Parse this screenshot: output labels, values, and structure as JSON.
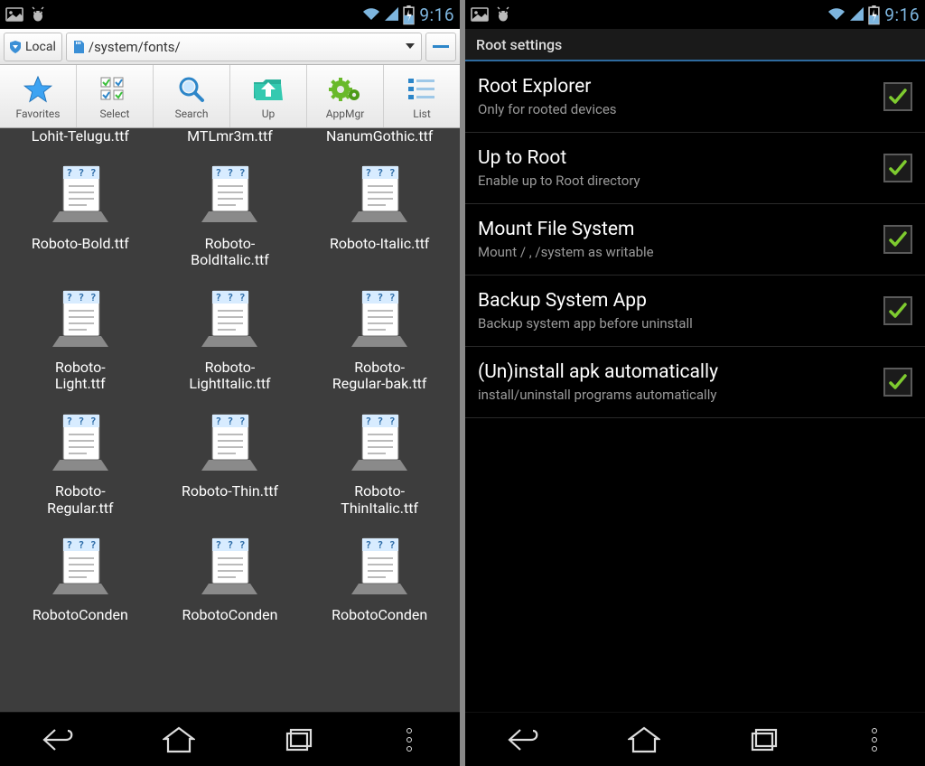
{
  "statusbar": {
    "time": "9:16"
  },
  "left": {
    "local_label": "Local",
    "path": "/system/fonts/",
    "toolbar": [
      {
        "label": "Favorites",
        "icon": "star"
      },
      {
        "label": "Select",
        "icon": "checks"
      },
      {
        "label": "Search",
        "icon": "search"
      },
      {
        "label": "Up",
        "icon": "up"
      },
      {
        "label": "AppMgr",
        "icon": "gears"
      },
      {
        "label": "List",
        "icon": "list"
      }
    ],
    "files_row0": [
      {
        "label": "Lohit-Telugu.ttf"
      },
      {
        "label": "MTLmr3m.ttf"
      },
      {
        "label": "NanumGothic.ttf"
      }
    ],
    "files": [
      {
        "label": "Roboto-Bold.ttf"
      },
      {
        "label": "Roboto-\nBoldItalic.ttf"
      },
      {
        "label": "Roboto-Italic.ttf"
      },
      {
        "label": "Roboto-\nLight.ttf"
      },
      {
        "label": "Roboto-\nLightItalic.ttf"
      },
      {
        "label": "Roboto-\nRegular-bak.ttf"
      },
      {
        "label": "Roboto-\nRegular.ttf"
      },
      {
        "label": "Roboto-Thin.ttf"
      },
      {
        "label": "Roboto-\nThinItalic.ttf"
      }
    ],
    "files_rowN": [
      {
        "label": "RobotoConden"
      },
      {
        "label": "RobotoConden"
      },
      {
        "label": "RobotoConden"
      }
    ]
  },
  "right": {
    "title": "Root settings",
    "items": [
      {
        "title": "Root Explorer",
        "subtitle": "Only for rooted devices",
        "checked": true
      },
      {
        "title": "Up to Root",
        "subtitle": "Enable up to Root directory",
        "checked": true
      },
      {
        "title": "Mount File System",
        "subtitle": "Mount / , /system as writable",
        "checked": true
      },
      {
        "title": "Backup System App",
        "subtitle": "Backup system app before uninstall",
        "checked": true
      },
      {
        "title": "(Un)install apk automatically",
        "subtitle": "install/uninstall programs automatically",
        "checked": true
      }
    ]
  }
}
